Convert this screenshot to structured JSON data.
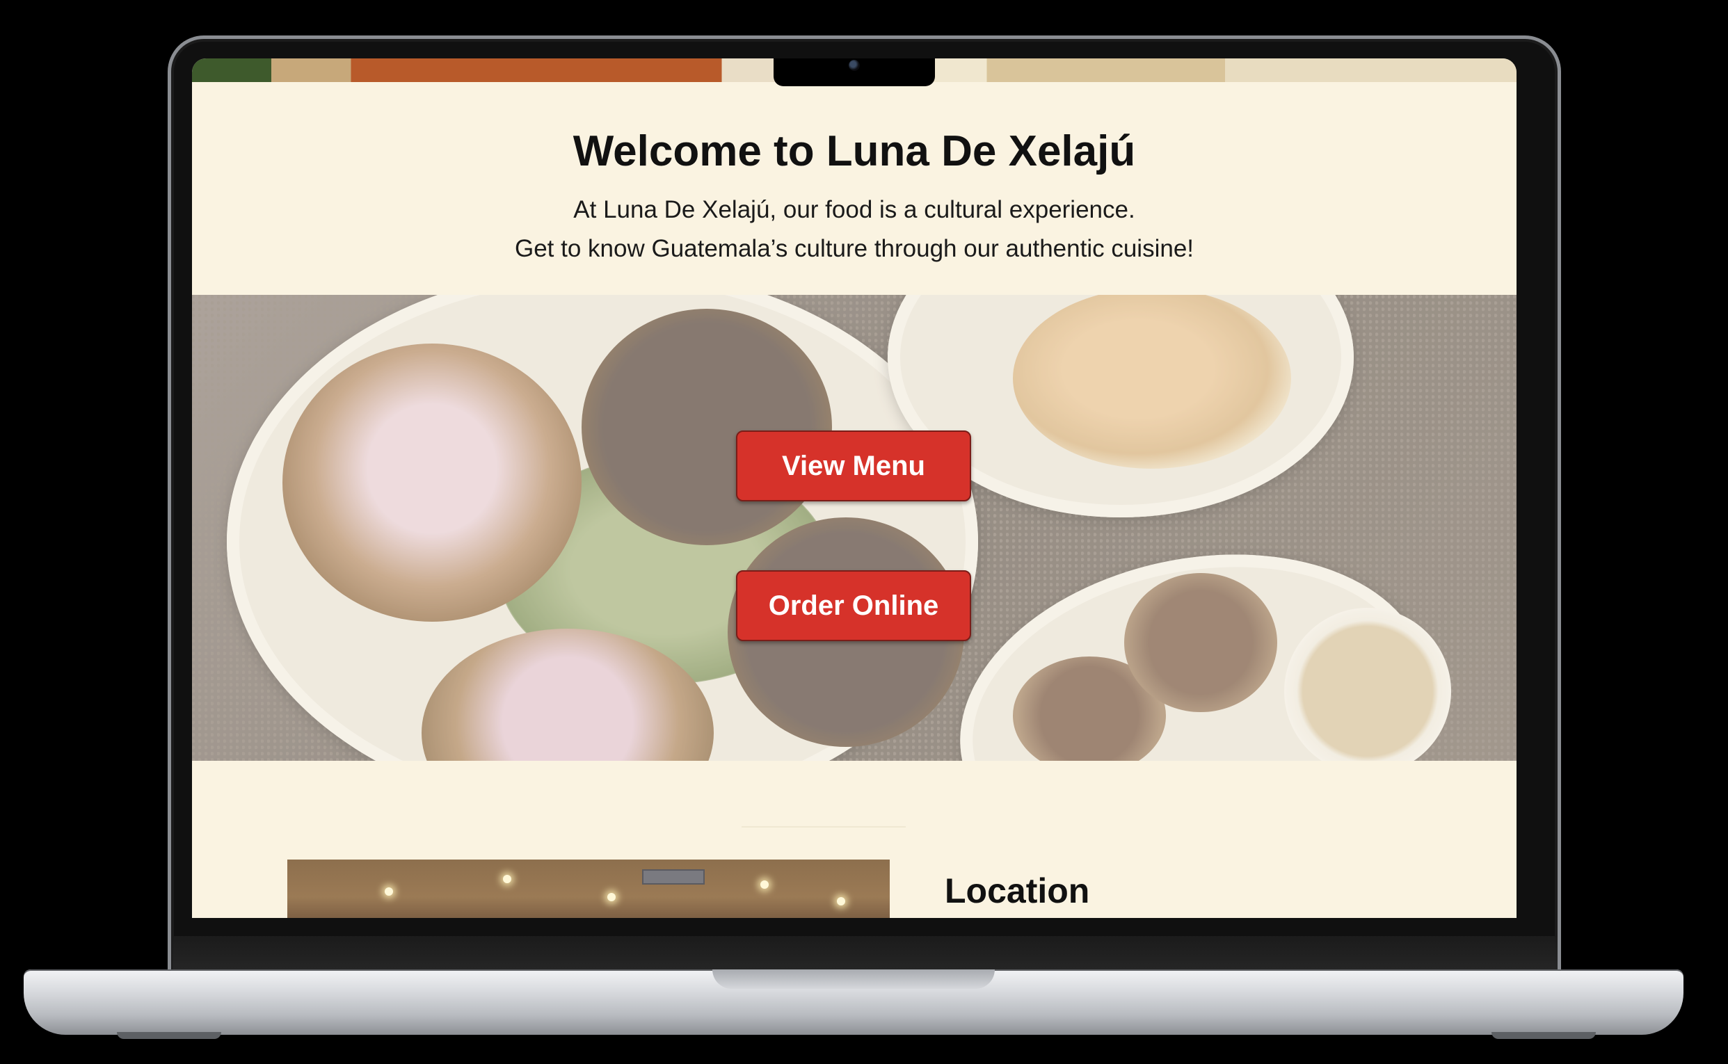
{
  "hero": {
    "title": "Welcome to Luna De Xelajú",
    "tagline_line1": "At Luna De Xelajú, our food is a cultural experience.",
    "tagline_line2": "Get to know Guatemala’s culture through our authentic cuisine!"
  },
  "buttons": {
    "view_menu": "View Menu",
    "order_online": "Order Online"
  },
  "location": {
    "heading": "Location"
  },
  "colors": {
    "page_background": "#faf3e1",
    "button_red": "#d6322a",
    "text_dark": "#111111"
  }
}
